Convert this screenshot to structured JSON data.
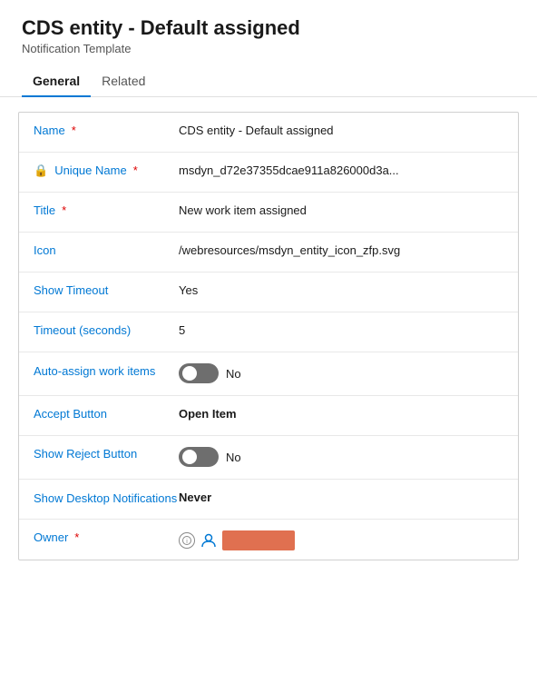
{
  "header": {
    "title": "CDS entity - Default assigned",
    "subtitle": "Notification Template"
  },
  "tabs": [
    {
      "id": "general",
      "label": "General",
      "active": true
    },
    {
      "id": "related",
      "label": "Related",
      "active": false
    }
  ],
  "fields": [
    {
      "id": "name",
      "label": "Name",
      "required": true,
      "value": "CDS entity - Default assigned",
      "bold": false,
      "type": "text"
    },
    {
      "id": "unique-name",
      "label": "Unique Name",
      "required": true,
      "value": "msdyn_d72e37355dcae911a826000d3a...",
      "bold": false,
      "type": "text",
      "lock": true
    },
    {
      "id": "title",
      "label": "Title",
      "required": true,
      "value": "New work item assigned",
      "bold": false,
      "type": "text"
    },
    {
      "id": "icon",
      "label": "Icon",
      "required": false,
      "value": "/webresources/msdyn_entity_icon_zfp.svg",
      "bold": false,
      "type": "text"
    },
    {
      "id": "show-timeout",
      "label": "Show Timeout",
      "required": false,
      "value": "Yes",
      "bold": false,
      "type": "text"
    },
    {
      "id": "timeout-seconds",
      "label": "Timeout (seconds)",
      "required": false,
      "value": "5",
      "bold": false,
      "type": "text"
    },
    {
      "id": "auto-assign",
      "label": "Auto-assign work items",
      "required": false,
      "value": "No",
      "bold": false,
      "type": "toggle"
    },
    {
      "id": "accept-button",
      "label": "Accept Button",
      "required": false,
      "value": "Open Item",
      "bold": true,
      "type": "text"
    },
    {
      "id": "show-reject-button",
      "label": "Show Reject Button",
      "required": false,
      "value": "No",
      "bold": false,
      "type": "toggle"
    },
    {
      "id": "show-desktop-notifications",
      "label": "Show Desktop Notifications",
      "required": false,
      "value": "Never",
      "bold": true,
      "type": "text",
      "multiline": true
    },
    {
      "id": "owner",
      "label": "Owner",
      "required": true,
      "value": "",
      "bold": false,
      "type": "owner"
    }
  ]
}
